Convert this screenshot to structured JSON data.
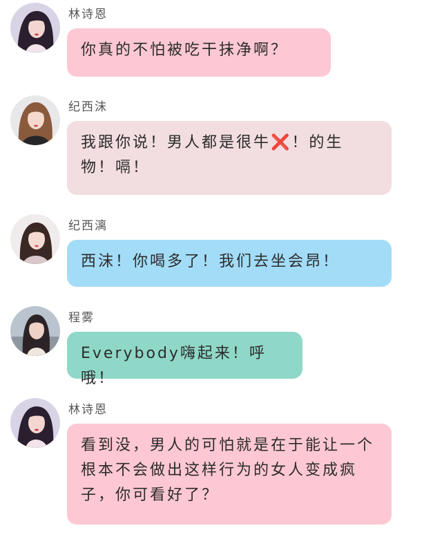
{
  "messages": [
    {
      "name": "林诗恩",
      "text": "你真的不怕被吃干抹净啊？"
    },
    {
      "name": "纪西沫",
      "text_before": "我跟你说！男人都是很牛",
      "mark": "❌",
      "text_after": "！的生物！嗝！"
    },
    {
      "name": "纪西漓",
      "text": "西沫！你喝多了！我们去坐会昂！"
    },
    {
      "name": "程雾",
      "text": "Everybody嗨起来！呼哦！"
    },
    {
      "name": "林诗恩",
      "text": "看到没，男人的可怕就是在于能让一个根本不会做出这样行为的女人变成疯子，你可看好了？"
    }
  ],
  "colors": {
    "bubble_pink": "#fdc8d3",
    "bubble_rose": "#f2dde0",
    "bubble_blue": "#a3dcf7",
    "bubble_teal": "#8fd8c8"
  }
}
